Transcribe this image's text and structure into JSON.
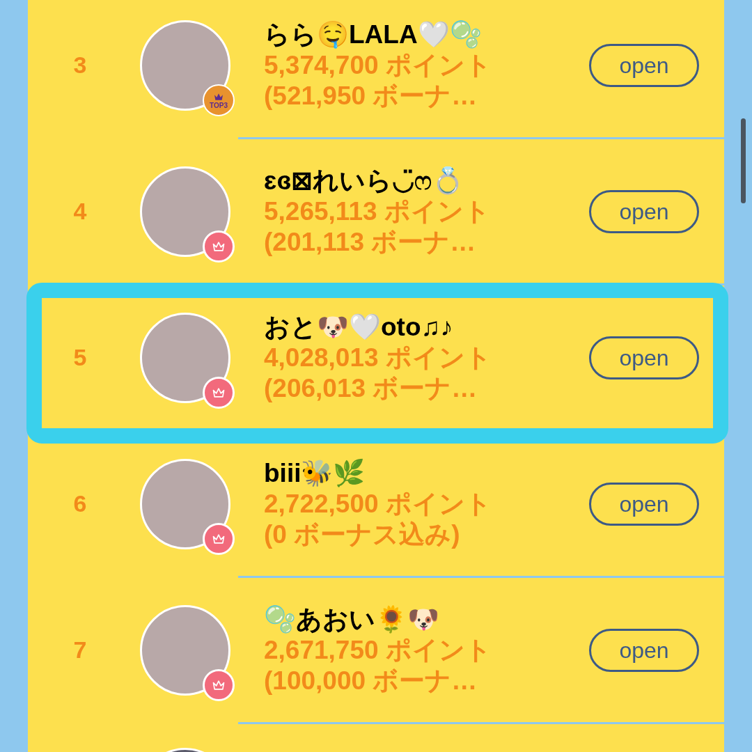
{
  "ranking": [
    {
      "rank": "3",
      "name": "らら🤤LALA🤍🫧",
      "points": "5,374,700 ポイント",
      "bonus": "(521,950 ボーナ…",
      "badge": {
        "kind": "top3",
        "label": "TOP3"
      },
      "selected": false,
      "button": "open"
    },
    {
      "rank": "4",
      "name": "ɛɞ⊠れいら◡̈ෆ💍",
      "points": "5,265,113 ポイント",
      "bonus": "(201,113 ボーナ…",
      "badge": {
        "kind": "crown"
      },
      "selected": false,
      "button": "open"
    },
    {
      "rank": "5",
      "name": "おと🐶🤍oto♫♪",
      "points": "4,028,013 ポイント",
      "bonus": "(206,013 ボーナ…",
      "badge": {
        "kind": "crown"
      },
      "selected": true,
      "button": "open"
    },
    {
      "rank": "6",
      "name": "biii🐝🌿",
      "points": "2,722,500 ポイント",
      "bonus": "(0 ボーナス込み)",
      "badge": {
        "kind": "crown"
      },
      "selected": false,
      "button": "open"
    },
    {
      "rank": "7",
      "name": "🫧あおい🌻🐶",
      "points": "2,671,750 ポイント",
      "bonus": "(100,000 ボーナ…",
      "badge": {
        "kind": "crown"
      },
      "selected": false,
      "button": "open"
    }
  ]
}
